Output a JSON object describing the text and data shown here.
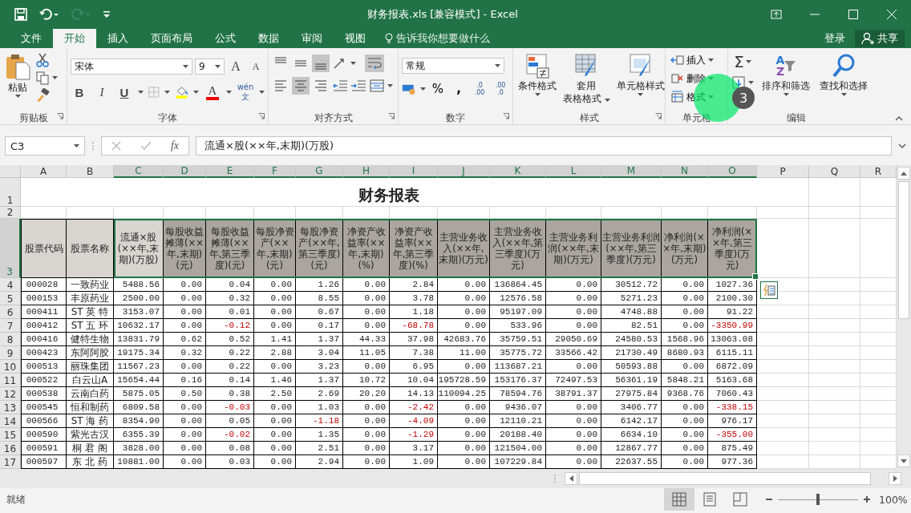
{
  "window": {
    "title": "财务报表.xls  [兼容模式] - Excel"
  },
  "tabs": [
    {
      "label": "文件",
      "selected": false
    },
    {
      "label": "开始",
      "selected": true
    },
    {
      "label": "插入",
      "selected": false
    },
    {
      "label": "页面布局",
      "selected": false
    },
    {
      "label": "公式",
      "selected": false
    },
    {
      "label": "数据",
      "selected": false
    },
    {
      "label": "审阅",
      "selected": false
    },
    {
      "label": "视图",
      "selected": false
    }
  ],
  "tell_me": "告诉我你想要做什么",
  "sign_in": "登录",
  "share": "共享",
  "ribbon": {
    "clipboard": {
      "label": "剪贴板",
      "paste": "粘贴"
    },
    "font": {
      "label": "字体",
      "family": "宋体",
      "size": "9",
      "grow": "A",
      "shrink": "A",
      "bold": "B",
      "italic": "I",
      "underline": "U",
      "color_letter": "A",
      "phonetic_top": "wén",
      "phonetic_bottom": "文"
    },
    "alignment": {
      "label": "对齐方式",
      "top_row": [
        {
          "kind": "top",
          "selected": false
        },
        {
          "kind": "middle",
          "selected": false
        },
        {
          "kind": "bottom",
          "selected": true
        }
      ],
      "bottom_row": [
        {
          "kind": "left",
          "selected": false
        },
        {
          "kind": "center",
          "selected": true
        },
        {
          "kind": "right",
          "selected": false
        }
      ],
      "wrap_selected": true
    },
    "number": {
      "label": "数字",
      "format": "常规",
      "percent": "%",
      "comma": ",",
      "inc_decimal": [
        ".0",
        ".00"
      ],
      "dec_decimal": [
        ".00",
        ".0"
      ]
    },
    "styles": {
      "label": "样式",
      "conditional": [
        "条件格式"
      ],
      "table": [
        "套用",
        "表格格式"
      ],
      "cell": [
        "单元格样式"
      ]
    },
    "cells": {
      "label": "单元格",
      "items": [
        {
          "kind": "insert",
          "label": "插入"
        },
        {
          "kind": "delete",
          "label": "删除"
        },
        {
          "kind": "format",
          "label": "格式"
        }
      ]
    },
    "editing": {
      "label": "编辑",
      "sigma": "Σ",
      "sort_letters": [
        "A",
        "Z"
      ],
      "sort": "排序和筛选",
      "find": "查找和选择"
    }
  },
  "tutorial_marker": {
    "step": "3"
  },
  "formula_bar": {
    "name_box": "C3",
    "fx": "fx",
    "formula": "流通×股(××年,末期)(万股)"
  },
  "columns": [
    {
      "label": "A",
      "selected": false
    },
    {
      "label": "B",
      "selected": false
    },
    {
      "label": "C",
      "selected": true
    },
    {
      "label": "D",
      "selected": true
    },
    {
      "label": "E",
      "selected": true
    },
    {
      "label": "F",
      "selected": true
    },
    {
      "label": "G",
      "selected": true
    },
    {
      "label": "H",
      "selected": true
    },
    {
      "label": "I",
      "selected": true
    },
    {
      "label": "J",
      "selected": true
    },
    {
      "label": "K",
      "selected": true
    },
    {
      "label": "L",
      "selected": true
    },
    {
      "label": "M",
      "selected": true
    },
    {
      "label": "N",
      "selected": true
    },
    {
      "label": "O",
      "selected": true
    },
    {
      "label": "P",
      "selected": false
    },
    {
      "label": "Q",
      "selected": false
    },
    {
      "label": "R",
      "selected": false
    }
  ],
  "row_numbers": [
    {
      "label": "1",
      "selected": false
    },
    {
      "label": "2",
      "selected": false
    },
    {
      "label": "3",
      "selected": true
    },
    {
      "label": "4",
      "selected": false
    },
    {
      "label": "5",
      "selected": false
    },
    {
      "label": "6",
      "selected": false
    },
    {
      "label": "7",
      "selected": false
    },
    {
      "label": "8",
      "selected": false
    },
    {
      "label": "9",
      "selected": false
    },
    {
      "label": "10",
      "selected": false
    },
    {
      "label": "11",
      "selected": false
    },
    {
      "label": "12",
      "selected": false
    },
    {
      "label": "13",
      "selected": false
    },
    {
      "label": "14",
      "selected": false
    },
    {
      "label": "15",
      "selected": false
    },
    {
      "label": "16",
      "selected": false
    },
    {
      "label": "17",
      "selected": false
    }
  ],
  "table": {
    "title": "财务报表",
    "header": [
      {
        "text": "股票代码",
        "highlighted": false
      },
      {
        "text": "股票名称",
        "highlighted": false
      },
      {
        "text": "流通×股(××年,末期)(万股)",
        "highlighted": false
      },
      {
        "text": "每股收益摊薄(××年,末期)(元)",
        "highlighted": true
      },
      {
        "text": "每股收益摊薄(××年,第三季度)(元)",
        "highlighted": true
      },
      {
        "text": "每股净资产(××年,末期)(元)",
        "highlighted": true
      },
      {
        "text": "每股净资产(××年,第三季度)(元)",
        "highlighted": true
      },
      {
        "text": "净资产收益率(××年,末期)(%)",
        "highlighted": true
      },
      {
        "text": "净资产收益率(××年,第三季度)(%)",
        "highlighted": true
      },
      {
        "text": "主营业务收入(××年,末期)(万元)",
        "highlighted": true
      },
      {
        "text": "主营业务收入(××年,第三季度)(万元)",
        "highlighted": true
      },
      {
        "text": "主营业务利润(××年,末期)(万元)",
        "highlighted": true
      },
      {
        "text": "主营业务利润(××年,第三季度)(万元)",
        "highlighted": true
      },
      {
        "text": "净利润(××年,末期)(万元)",
        "highlighted": true
      },
      {
        "text": "净利润(××年,第三季度)(万元)",
        "highlighted": true
      }
    ],
    "rows": [
      {
        "code": "000028",
        "name": "一致药业",
        "values": [
          "5488.56",
          "0.00",
          "0.04",
          "0.00",
          "1.26",
          "0.00",
          "2.84",
          "0.00",
          "136864.45",
          "0.00",
          "30512.72",
          "0.00",
          "1027.36"
        ],
        "red": [
          false,
          false,
          false,
          false,
          false,
          false,
          false,
          false,
          false,
          false,
          false,
          false,
          false
        ]
      },
      {
        "code": "000153",
        "name": "丰原药业",
        "values": [
          "2500.00",
          "0.00",
          "0.32",
          "0.00",
          "8.55",
          "0.00",
          "3.78",
          "0.00",
          "12576.58",
          "0.00",
          "5271.23",
          "0.00",
          "2100.30"
        ],
        "red": [
          false,
          false,
          false,
          false,
          false,
          false,
          false,
          false,
          false,
          false,
          false,
          false,
          false
        ]
      },
      {
        "code": "000411",
        "name": "ST 英 特",
        "values": [
          "3153.07",
          "0.00",
          "0.01",
          "0.00",
          "0.67",
          "0.00",
          "1.18",
          "0.00",
          "95197.09",
          "0.00",
          "4748.88",
          "0.00",
          "91.22"
        ],
        "red": [
          false,
          false,
          false,
          false,
          false,
          false,
          false,
          false,
          false,
          false,
          false,
          false,
          false
        ]
      },
      {
        "code": "000412",
        "name": "ST 五 环",
        "values": [
          "10632.17",
          "0.00",
          "-0.12",
          "0.00",
          "0.17",
          "0.00",
          "-68.78",
          "0.00",
          "533.96",
          "0.00",
          "82.51",
          "0.00",
          "-3350.99"
        ],
        "red": [
          false,
          false,
          true,
          false,
          false,
          false,
          true,
          false,
          false,
          false,
          false,
          false,
          true
        ]
      },
      {
        "code": "000416",
        "name": "健特生物",
        "values": [
          "13831.79",
          "0.62",
          "0.52",
          "1.41",
          "1.37",
          "44.33",
          "37.98",
          "42683.76",
          "35759.51",
          "29050.69",
          "24580.53",
          "1568.96",
          "13063.08"
        ],
        "red": [
          false,
          false,
          false,
          false,
          false,
          false,
          false,
          false,
          false,
          false,
          false,
          false,
          false
        ]
      },
      {
        "code": "000423",
        "name": "东阿阿胶",
        "values": [
          "19175.34",
          "0.32",
          "0.22",
          "2.88",
          "3.04",
          "11.05",
          "7.38",
          "11.00",
          "35775.72",
          "33566.42",
          "21730.49",
          "8680.93",
          "6115.11"
        ],
        "red": [
          false,
          false,
          false,
          false,
          false,
          false,
          false,
          false,
          false,
          false,
          false,
          false,
          false
        ]
      },
      {
        "code": "000513",
        "name": "丽珠集团",
        "values": [
          "11567.23",
          "0.00",
          "0.22",
          "0.00",
          "3.23",
          "0.00",
          "6.95",
          "0.00",
          "113687.21",
          "0.00",
          "50593.88",
          "0.00",
          "6872.09"
        ],
        "red": [
          false,
          false,
          false,
          false,
          false,
          false,
          false,
          false,
          false,
          false,
          false,
          false,
          false
        ]
      },
      {
        "code": "000522",
        "name": "白云山A",
        "values": [
          "15654.44",
          "0.16",
          "0.14",
          "1.46",
          "1.37",
          "10.72",
          "10.04",
          "195728.59",
          "153176.37",
          "72497.53",
          "56361.19",
          "5848.21",
          "5163.68"
        ],
        "red": [
          false,
          false,
          false,
          false,
          false,
          false,
          false,
          false,
          false,
          false,
          false,
          false,
          false
        ]
      },
      {
        "code": "000538",
        "name": "云南白药",
        "values": [
          "5875.05",
          "0.50",
          "0.38",
          "2.50",
          "2.69",
          "20.20",
          "14.13",
          "110094.25",
          "78594.76",
          "38791.37",
          "27975.84",
          "9368.76",
          "7060.43"
        ],
        "red": [
          false,
          false,
          false,
          false,
          false,
          false,
          false,
          false,
          false,
          false,
          false,
          false,
          false
        ]
      },
      {
        "code": "000545",
        "name": "恒和制药",
        "values": [
          "6809.58",
          "0.00",
          "-0.03",
          "0.00",
          "1.03",
          "0.00",
          "-2.42",
          "0.00",
          "9436.07",
          "0.00",
          "3406.77",
          "0.00",
          "-338.15"
        ],
        "red": [
          false,
          false,
          true,
          false,
          false,
          false,
          true,
          false,
          false,
          false,
          false,
          false,
          true
        ]
      },
      {
        "code": "000566",
        "name": "ST 海 药",
        "values": [
          "8354.90",
          "0.00",
          "0.05",
          "0.00",
          "-1.18",
          "0.00",
          "-4.09",
          "0.00",
          "12110.21",
          "0.00",
          "6142.17",
          "0.00",
          "976.17"
        ],
        "red": [
          false,
          false,
          false,
          false,
          true,
          false,
          true,
          false,
          false,
          false,
          false,
          false,
          false
        ]
      },
      {
        "code": "000590",
        "name": "紫光古汉",
        "values": [
          "6355.39",
          "0.00",
          "-0.02",
          "0.00",
          "1.35",
          "0.00",
          "-1.29",
          "0.00",
          "20188.40",
          "0.00",
          "6634.10",
          "0.00",
          "-355.00"
        ],
        "red": [
          false,
          false,
          true,
          false,
          false,
          false,
          true,
          false,
          false,
          false,
          false,
          false,
          true
        ]
      },
      {
        "code": "000591",
        "name": "桐 君 阁",
        "values": [
          "3828.00",
          "0.00",
          "0.08",
          "0.00",
          "2.51",
          "0.00",
          "3.17",
          "0.00",
          "121504.00",
          "0.00",
          "12867.77",
          "0.00",
          "875.49"
        ],
        "red": [
          false,
          false,
          false,
          false,
          false,
          false,
          false,
          false,
          false,
          false,
          false,
          false,
          false
        ]
      },
      {
        "code": "000597",
        "name": "东 北 药",
        "values": [
          "10881.00",
          "0.00",
          "0.03",
          "0.00",
          "2.94",
          "0.00",
          "1.09",
          "0.00",
          "107229.84",
          "0.00",
          "22637.55",
          "0.00",
          "977.36"
        ],
        "red": [
          false,
          false,
          false,
          false,
          false,
          false,
          false,
          false,
          false,
          false,
          false,
          false,
          false
        ]
      }
    ]
  },
  "status": {
    "text": "就绪",
    "views": [
      {
        "kind": "normal",
        "selected": true
      },
      {
        "kind": "page-layout",
        "selected": false
      },
      {
        "kind": "page-break",
        "selected": false
      }
    ],
    "zoom": {
      "level": 0.5,
      "reading": "100%"
    }
  }
}
